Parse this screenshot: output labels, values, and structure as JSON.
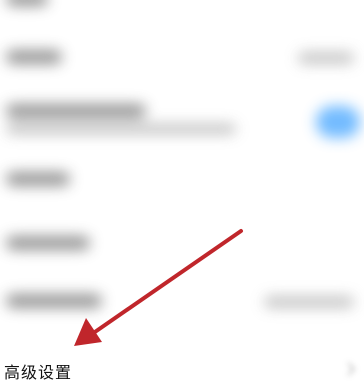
{
  "settings_list": {
    "rows": [
      {
        "kind": "plain"
      },
      {
        "kind": "with-value"
      },
      {
        "kind": "with-toggle",
        "toggle_on": true
      },
      {
        "kind": "plain"
      },
      {
        "kind": "plain"
      },
      {
        "kind": "with-value"
      }
    ]
  },
  "advanced_settings": {
    "label": "高级设置"
  },
  "annotation": {
    "arrow_color": "#c0262b"
  },
  "colors": {
    "toggle_accent": "#64b4ff"
  }
}
